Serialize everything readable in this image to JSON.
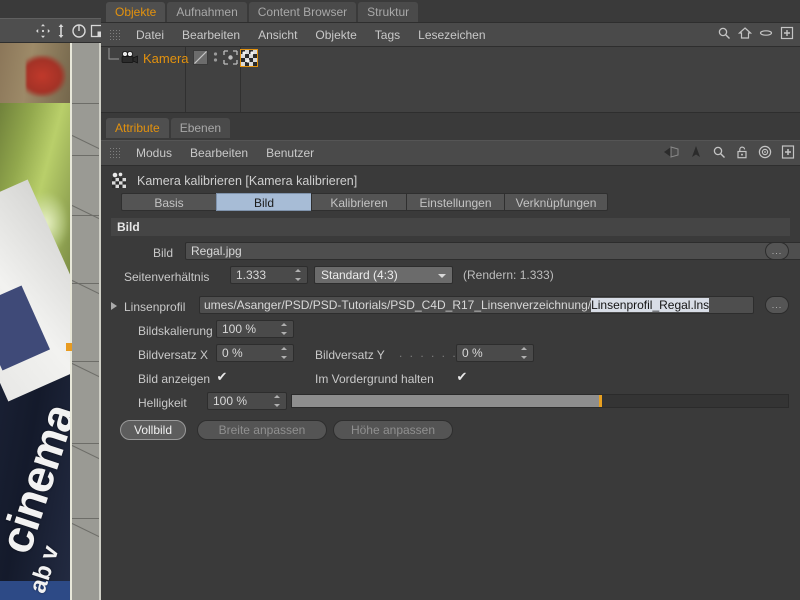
{
  "viewport": {
    "nav_icons": [
      "pan-icon",
      "dolly-icon",
      "rotate-icon",
      "maximize-icon"
    ],
    "photo_text_1": "cinema",
    "photo_text_2": "ab v"
  },
  "object_manager": {
    "tabs": [
      {
        "label": "Objekte",
        "active": true
      },
      {
        "label": "Aufnahmen",
        "active": false
      },
      {
        "label": "Content Browser",
        "active": false
      },
      {
        "label": "Struktur",
        "active": false
      }
    ],
    "menu": [
      "Datei",
      "Bearbeiten",
      "Ansicht",
      "Objekte",
      "Tags",
      "Lesezeichen"
    ],
    "menu_icons": [
      "search-icon",
      "home-icon",
      "link-icon",
      "add-icon"
    ],
    "object": {
      "name": "Kamera",
      "icon": "camera-icon",
      "tags": [
        "visibility-tag",
        "dots-tag",
        "calibrator-tag",
        "camera-calibrator-tag"
      ]
    }
  },
  "attribute_manager": {
    "tabs": [
      {
        "label": "Attribute",
        "active": true
      },
      {
        "label": "Ebenen",
        "active": false
      }
    ],
    "menu": [
      "Modus",
      "Bearbeiten",
      "Benutzer"
    ],
    "menu_icons": [
      "back-arrow-icon",
      "up-arrow-icon",
      "search-icon",
      "lock-icon",
      "target-icon",
      "add-panel-icon"
    ],
    "object_title": "Kamera kalibrieren [Kamera kalibrieren]",
    "object_title_icon": "camera-calibrator-icon",
    "page_tabs": [
      {
        "label": "Basis",
        "active": false
      },
      {
        "label": "Bild",
        "active": true
      },
      {
        "label": "Kalibrieren",
        "active": false
      },
      {
        "label": "Einstellungen",
        "active": false
      },
      {
        "label": "Verknüpfungen",
        "active": false
      }
    ],
    "group_bild": "Bild",
    "fields": {
      "bild_label": "Bild",
      "bild_value": "Regal.jpg",
      "bild_browse": "...",
      "seitenverhaeltnis_label": "Seitenverhältnis",
      "seitenverhaeltnis_value": "1.333",
      "preset_value": "Standard (4:3)",
      "render_hint": "(Rendern: 1.333)",
      "linsenprofil_label": "Linsenprofil",
      "linsenprofil_path": "umes/Asanger/PSD/PSD-Tutorials/PSD_C4D_R17_Linsenverzeichnung/",
      "linsenprofil_selected": "Linsenprofil_Regal.lns",
      "linsenprofil_browse": "...",
      "bildskalierung_label": "Bildskalierung",
      "bildskalierung_value": "100 %",
      "bildversatz_x_label": "Bildversatz X",
      "bildversatz_x_value": "0 %",
      "bildversatz_y_label": "Bildversatz Y",
      "bildversatz_y_leader": ". . . . . . . .",
      "bildversatz_y_value": "0 %",
      "bild_anzeigen_label": "Bild anzeigen",
      "bild_anzeigen_checked": "✔",
      "vordergrund_label": "Im Vordergrund halten",
      "vordergrund_checked": "✔",
      "helligkeit_label": "Helligkeit",
      "helligkeit_value": "100 %",
      "helligkeit_percent": 62
    },
    "buttons": [
      {
        "label": "Vollbild",
        "state": "active"
      },
      {
        "label": "Breite anpassen",
        "state": "dim"
      },
      {
        "label": "Höhe anpassen",
        "state": "dim"
      }
    ]
  },
  "colors": {
    "accent_orange": "#e3920e",
    "active_tab_blue": "#a7bcd6",
    "panel_bg": "#3a3a3a",
    "bar_bg": "#4a4a4a",
    "slider_knob": "#e8a020"
  }
}
